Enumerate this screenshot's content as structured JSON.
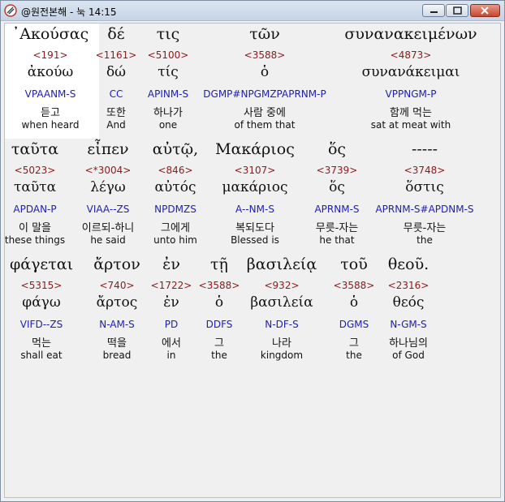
{
  "window": {
    "title": "@원전본해 - 눅 14:15"
  },
  "words": [
    {
      "greek": "᾿Ακούσας",
      "strong": "<191>",
      "lemma": "ἀκούω",
      "parsing": "VPAANM-S",
      "korean": "듣고",
      "english": "when heard"
    },
    {
      "greek": "δέ",
      "strong": "<1161>",
      "lemma": "δώ",
      "parsing": "CC",
      "korean": "또한",
      "english": "And"
    },
    {
      "greek": "τις",
      "strong": "<5100>",
      "lemma": "τίς",
      "parsing": "APINM-S",
      "korean": "하나가",
      "english": "one"
    },
    {
      "greek": "τῶν",
      "strong": "<3588>",
      "lemma": "ὁ",
      "parsing": "DGMP#NPGMZPAPRNM-P",
      "korean": "사람 중에",
      "english": "of them that"
    },
    {
      "greek": "συνανακειμένων",
      "strong": "<4873>",
      "lemma": "συνανάκειμαι",
      "parsing": "VPPNGM-P",
      "korean": "함께 먹는",
      "english": "sat at meat with"
    },
    {
      "greek": "ταῦτα",
      "strong": "<5023>",
      "lemma": "ταῦτα",
      "parsing": "APDAN-P",
      "korean": "이 말을",
      "english": "these things"
    },
    {
      "greek": "εἶπεν",
      "strong": "<*3004>",
      "lemma": "λέγω",
      "parsing": "VIAA--ZS",
      "korean": "이르되-하니",
      "english": "he said"
    },
    {
      "greek": "αὐτῷ,",
      "strong": "<846>",
      "lemma": "αὐτός",
      "parsing": "NPDMZS",
      "korean": "그에게",
      "english": "unto him"
    },
    {
      "greek": "Μακάριος",
      "strong": "<3107>",
      "lemma": "μακάριος",
      "parsing": "A--NM-S",
      "korean": "복되도다",
      "english": "Blessed is"
    },
    {
      "greek": "ὅς",
      "strong": "<3739>",
      "lemma": "ὅς",
      "parsing": "APRNM-S",
      "korean": "무릇-자는",
      "english": "he that"
    },
    {
      "greek": "-----",
      "strong": "<3748>",
      "lemma": "ὅστις",
      "parsing": "APRNM-S#APDNM-S",
      "korean": "무릇-자는",
      "english": "the"
    },
    {
      "greek": "φάγεται",
      "strong": "<5315>",
      "lemma": "φάγω",
      "parsing": "VIFD--ZS",
      "korean": "먹는",
      "english": "shall eat"
    },
    {
      "greek": "ἄρτον",
      "strong": "<740>",
      "lemma": "ἄρτος",
      "parsing": "N-AM-S",
      "korean": "떡을",
      "english": "bread"
    },
    {
      "greek": "ἐν",
      "strong": "<1722>",
      "lemma": "ἐν",
      "parsing": "PD",
      "korean": "에서",
      "english": "in"
    },
    {
      "greek": "τῇ",
      "strong": "<3588>",
      "lemma": "ὁ",
      "parsing": "DDFS",
      "korean": "그",
      "english": "the"
    },
    {
      "greek": "βασιλείᾳ",
      "strong": "<932>",
      "lemma": "βασιλεία",
      "parsing": "N-DF-S",
      "korean": "나라",
      "english": "kingdom"
    },
    {
      "greek": "τοῦ",
      "strong": "<3588>",
      "lemma": "ὁ",
      "parsing": "DGMS",
      "korean": "그",
      "english": "the"
    },
    {
      "greek": "θεοῦ.",
      "strong": "<2316>",
      "lemma": "θεός",
      "parsing": "N-GM-S",
      "korean": "하나님의",
      "english": "of God"
    }
  ],
  "colors": {
    "strong": "#8b1a1a",
    "parsing": "#1d1db8",
    "highlight": "#ffffff"
  }
}
